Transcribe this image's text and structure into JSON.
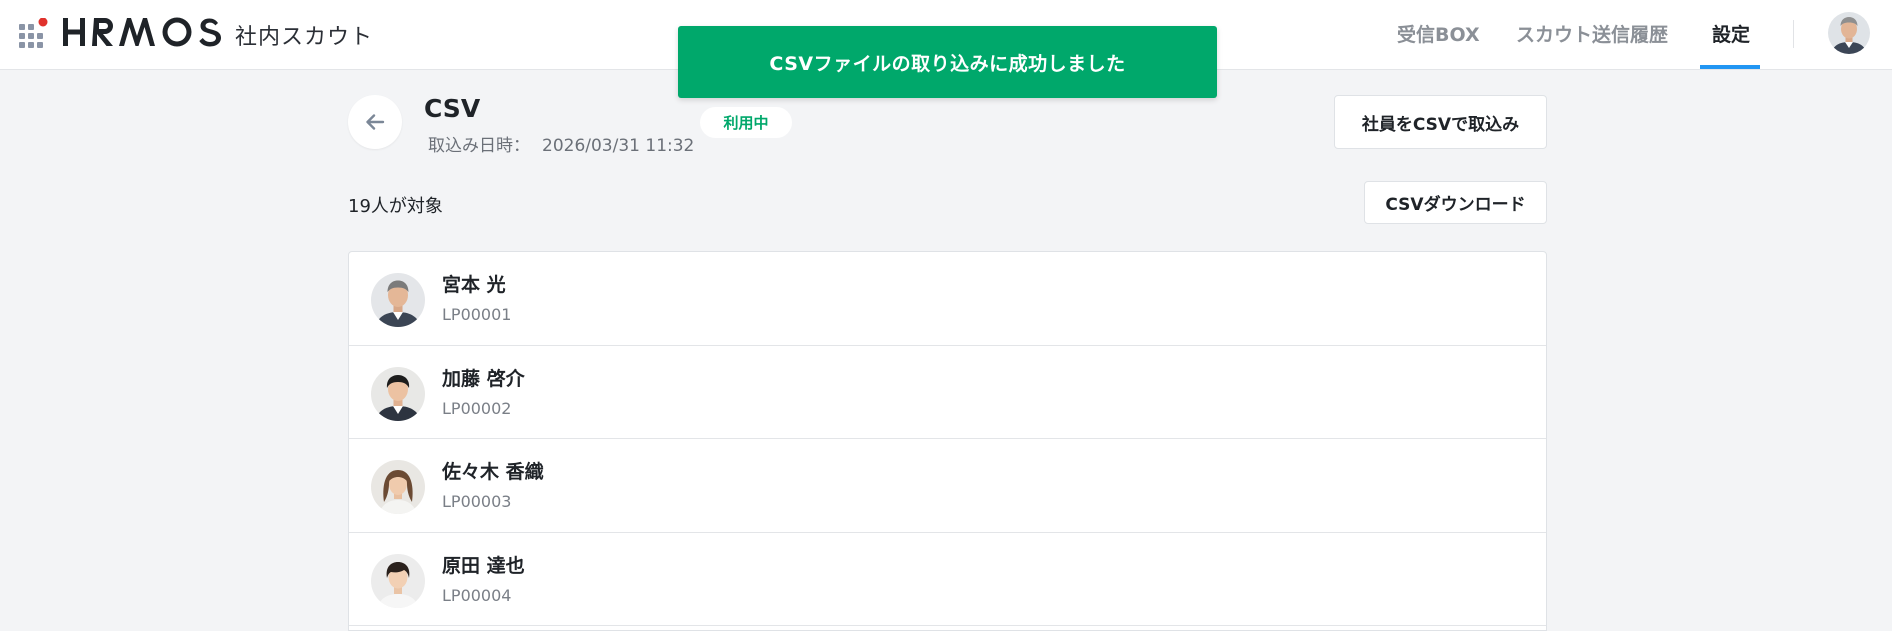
{
  "header": {
    "brand": "HRMOS",
    "app_name": "社内スカウト",
    "nav": [
      {
        "label": "受信BOX",
        "active": false
      },
      {
        "label": "スカウト送信履歴",
        "active": false
      },
      {
        "label": "設定",
        "active": true
      }
    ],
    "accent_color": "#2196f3"
  },
  "toast": {
    "message": "CSVファイルの取り込みに成功しました",
    "color": "#00a86b"
  },
  "page": {
    "title": "CSV",
    "import_date_label": "取込み日時：",
    "import_date_value": "2026/03/31 11:32",
    "status_badge": "利用中",
    "import_button": "社員をCSVで取込み",
    "download_button": "CSVダウンロード",
    "target_count": "19人が対象"
  },
  "employees": [
    {
      "name": "宮本 光",
      "id": "LP00001"
    },
    {
      "name": "加藤 啓介",
      "id": "LP00002"
    },
    {
      "name": "佐々木 香織",
      "id": "LP00003"
    },
    {
      "name": "原田 達也",
      "id": "LP00004"
    }
  ]
}
